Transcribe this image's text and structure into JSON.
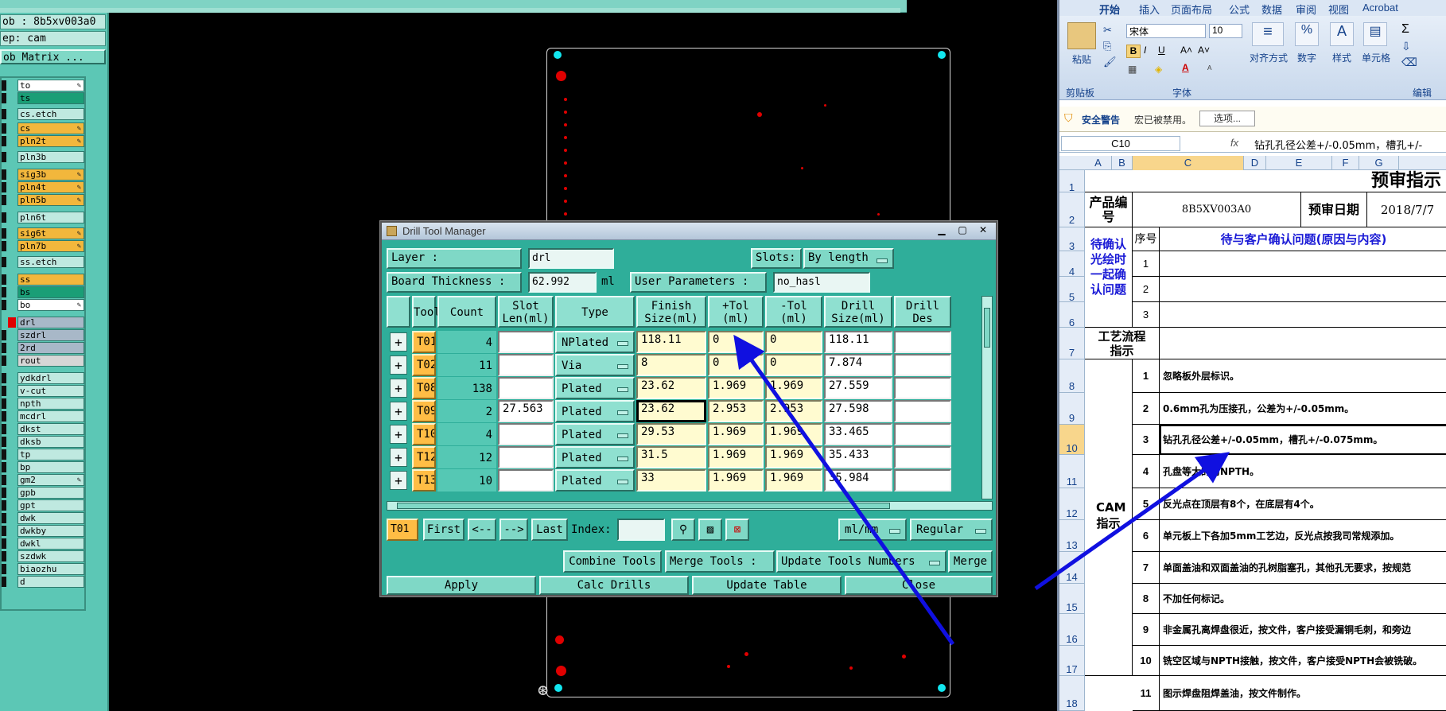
{
  "cam": {
    "job_line": "ob : 8b5xv003a0",
    "step_line": "ep: cam",
    "matrix_button": "ob Matrix ...",
    "layers": [
      {
        "name": "to",
        "color": "#ffffff",
        "edit": true
      },
      {
        "name": "ts",
        "color": "#1a9e76",
        "edit": false
      },
      {
        "name": "cs.etch",
        "color": "#bfe9e0",
        "edit": false
      },
      {
        "name": "cs",
        "color": "#f2b73c",
        "edit": true
      },
      {
        "name": "pln2t",
        "color": "#f2b73c",
        "edit": true
      },
      {
        "name": "pln3b",
        "color": "#bfe9e0",
        "edit": false
      },
      {
        "name": "sig3b",
        "color": "#f2b73c",
        "edit": true
      },
      {
        "name": "pln4t",
        "color": "#f2b73c",
        "edit": true
      },
      {
        "name": "pln5b",
        "color": "#f2b73c",
        "edit": true
      },
      {
        "name": "pln6t",
        "color": "#bfe9e0",
        "edit": false
      },
      {
        "name": "sig6t",
        "color": "#f2b73c",
        "edit": true
      },
      {
        "name": "pln7b",
        "color": "#f2b73c",
        "edit": true
      },
      {
        "name": "ss.etch",
        "color": "#bfe9e0",
        "edit": false
      },
      {
        "name": "ss",
        "color": "#f2b73c",
        "edit": false
      },
      {
        "name": "bs",
        "color": "#1a9e76",
        "edit": false
      },
      {
        "name": "bo",
        "color": "#ffffff",
        "edit": true
      },
      {
        "name": "drl",
        "color": "#a8b8c8",
        "edit": false
      },
      {
        "name": "szdrl",
        "color": "#a8b8c8",
        "edit": false
      },
      {
        "name": "2rd",
        "color": "#a8b8c8",
        "edit": false
      },
      {
        "name": "rout",
        "color": "#d6d6d6",
        "edit": false
      },
      {
        "name": "ydkdrl",
        "color": "#bfe9e0",
        "edit": false
      },
      {
        "name": "v-cut",
        "color": "#bfe9e0",
        "edit": false
      },
      {
        "name": "npth",
        "color": "#bfe9e0",
        "edit": false
      },
      {
        "name": "mcdrl",
        "color": "#bfe9e0",
        "edit": false
      },
      {
        "name": "dkst",
        "color": "#bfe9e0",
        "edit": false
      },
      {
        "name": "dksb",
        "color": "#bfe9e0",
        "edit": false
      },
      {
        "name": "tp",
        "color": "#bfe9e0",
        "edit": false
      },
      {
        "name": "bp",
        "color": "#bfe9e0",
        "edit": false
      },
      {
        "name": "gm2",
        "color": "#bfe9e0",
        "edit": true
      },
      {
        "name": "gpb",
        "color": "#bfe9e0",
        "edit": false
      },
      {
        "name": "gpt",
        "color": "#bfe9e0",
        "edit": false
      },
      {
        "name": "dwk",
        "color": "#bfe9e0",
        "edit": false
      },
      {
        "name": "dwkby",
        "color": "#bfe9e0",
        "edit": false
      },
      {
        "name": "dwkl",
        "color": "#bfe9e0",
        "edit": false
      },
      {
        "name": "szdwk",
        "color": "#bfe9e0",
        "edit": false
      },
      {
        "name": "biaozhu",
        "color": "#bfe9e0",
        "edit": false
      },
      {
        "name": "d",
        "color": "#bfe9e0",
        "edit": false
      }
    ]
  },
  "dtm": {
    "title": "Drill Tool Manager",
    "layer_label": "Layer          :",
    "layer_value": "drl",
    "slots_label": "Slots:",
    "slots_value": "By length",
    "thickness_label": "Board Thickness :",
    "thickness_value": "62.992",
    "thickness_unit": "ml",
    "user_params_label": "User Parameters :",
    "user_params_value": "no_hasl",
    "columns": [
      "Tool",
      "Count",
      "Slot Len(ml)",
      "Type",
      "Finish Size(ml)",
      "+Tol (ml)",
      "-Tol (ml)",
      "Drill Size(ml)",
      "Drill Des"
    ],
    "rows": [
      {
        "tool": "T01",
        "count": "4",
        "slot": "",
        "type": "NPlated",
        "finish": "118.11",
        "ptol": "0",
        "mtol": "0",
        "drill": "118.11",
        "des": ""
      },
      {
        "tool": "T02",
        "count": "11",
        "slot": "",
        "type": "Via",
        "finish": "8",
        "ptol": "0",
        "mtol": "0",
        "drill": "7.874",
        "des": ""
      },
      {
        "tool": "T08",
        "count": "138",
        "slot": "",
        "type": "Plated",
        "finish": "23.62",
        "ptol": "1.969",
        "mtol": "1.969",
        "drill": "27.559",
        "des": ""
      },
      {
        "tool": "T09",
        "count": "2",
        "slot": "27.563",
        "type": "Plated",
        "finish": "23.62",
        "ptol": "2.953",
        "mtol": "2.953",
        "drill": "27.598",
        "des": ""
      },
      {
        "tool": "T10",
        "count": "4",
        "slot": "",
        "type": "Plated",
        "finish": "29.53",
        "ptol": "1.969",
        "mtol": "1.969",
        "drill": "33.465",
        "des": ""
      },
      {
        "tool": "T12",
        "count": "12",
        "slot": "",
        "type": "Plated",
        "finish": "31.5",
        "ptol": "1.969",
        "mtol": "1.969",
        "drill": "35.433",
        "des": ""
      },
      {
        "tool": "T13",
        "count": "10",
        "slot": "",
        "type": "Plated",
        "finish": "33",
        "ptol": "1.969",
        "mtol": "1.969",
        "drill": "35.984",
        "des": ""
      }
    ],
    "current_tool": "T01",
    "nav": {
      "first": "First",
      "prev": "<--",
      "next": "-->",
      "last": "Last",
      "index_label": "Index:"
    },
    "units_value": "ml/mm",
    "mode_value": "Regular",
    "combine": "Combine Tools",
    "merge_label": "Merge Tools :",
    "merge_value": "Update Tools Numbers",
    "merge": "Merge",
    "apply": "Apply",
    "calc": "Calc Drills",
    "update": "Update Table",
    "close": "Close"
  },
  "excel": {
    "tabs": [
      "开始",
      "插入",
      "页面布局",
      "公式",
      "数据",
      "审阅",
      "视图",
      "Acrobat"
    ],
    "font_name": "宋体",
    "font_size": "10",
    "groups": {
      "clipboard": "剪贴板",
      "font": "字体",
      "edit": "编辑"
    },
    "buttons": {
      "paste": "粘贴",
      "align": "对齐方式",
      "number": "数字",
      "styles": "样式",
      "cells": "单元格"
    },
    "security_title": "安全警告",
    "security_msg": "宏已被禁用。",
    "options": "选项...",
    "name_box": "C10",
    "formula": "钻孔孔径公差+/-0.05mm，槽孔+/-",
    "columns": [
      "A",
      "B",
      "C",
      "D",
      "E",
      "F",
      "G"
    ],
    "row_numbers": [
      "1",
      "2",
      "3",
      "4",
      "5",
      "6",
      "7",
      "8",
      "9",
      "10",
      "11",
      "12",
      "13",
      "14",
      "15",
      "16",
      "17",
      "18"
    ],
    "title": "预审指示",
    "product_label": "产品编号",
    "product_value": "8B5XV003A0",
    "date_label": "预审日期",
    "date_value": "2018/7/7",
    "seq_label": "序号",
    "confirm_header": "待与客户确认问题(原因与内容)",
    "confirm_label": "待确认光绘时一起确认问题",
    "confirm_nums": [
      "1",
      "2",
      "3"
    ],
    "process_label": "工艺流程指示",
    "cam_label": "CAM指示",
    "instructions": [
      {
        "n": "1",
        "t": "忽略板外层标识。"
      },
      {
        "n": "2",
        "t": "0.6mm孔为压接孔，公差为+/-0.05mm。"
      },
      {
        "n": "3",
        "t": "钻孔孔径公差+/-0.05mm，槽孔+/-0.075mm。"
      },
      {
        "n": "4",
        "t": "孔盘等大的为NPTH。"
      },
      {
        "n": "5",
        "t": "反光点在顶层有8个，在底层有4个。"
      },
      {
        "n": "6",
        "t": "单元板上下各加5mm工艺边，反光点按我司常规添加。"
      },
      {
        "n": "7",
        "t": "单面盖油和双面盖油的孔树脂塞孔，其他孔无要求，按规范"
      },
      {
        "n": "8",
        "t": "不加任何标记。"
      },
      {
        "n": "9",
        "t": "非金属孔离焊盘很近，按文件，客户接受漏铜毛刺，和旁边"
      },
      {
        "n": "10",
        "t": "铣空区域与NPTH接触，按文件，客户接受NPTH会被铣破。"
      },
      {
        "n": "11",
        "t": "图示焊盘阻焊盖油，按文件制作。"
      }
    ]
  }
}
